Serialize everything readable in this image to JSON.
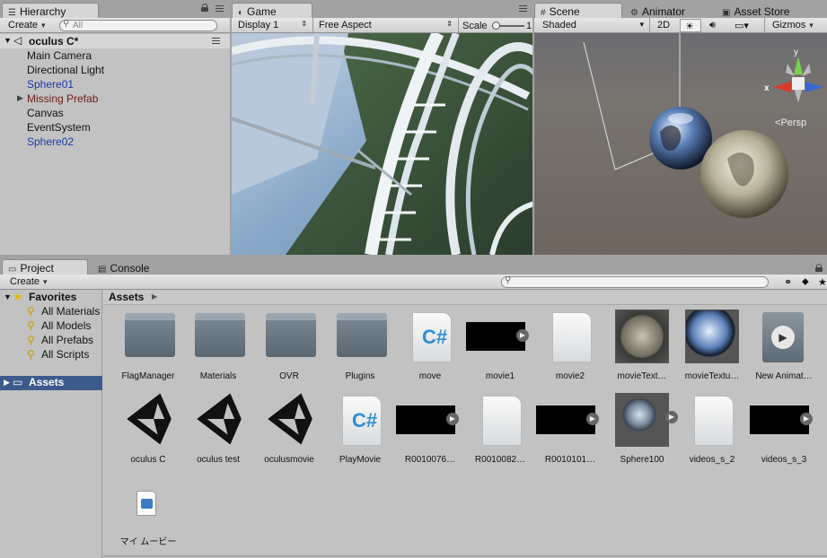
{
  "hierarchy": {
    "tab": "Hierarchy",
    "create": "Create",
    "search_placeholder": "All",
    "scene_name": "oculus C*",
    "items": [
      {
        "label": "Main Camera",
        "style": "normal"
      },
      {
        "label": "Directional Light",
        "style": "normal"
      },
      {
        "label": "Sphere01",
        "style": "blue"
      },
      {
        "label": "Missing Prefab",
        "style": "brown"
      },
      {
        "label": "Canvas",
        "style": "normal"
      },
      {
        "label": "EventSystem",
        "style": "normal"
      },
      {
        "label": "Sphere02",
        "style": "blue"
      }
    ]
  },
  "game": {
    "tab": "Game",
    "display": "Display 1",
    "aspect": "Free Aspect",
    "scale_label": "Scale",
    "scale_value": "1"
  },
  "scene": {
    "tab": "Scene",
    "tab_animator": "Animator",
    "tab_asset_store": "Asset Store",
    "shading": "Shaded",
    "mode_2d": "2D",
    "gizmos": "Gizmos",
    "persp_label": "Persp",
    "axis_y": "y",
    "axis_x": "x"
  },
  "project": {
    "tab": "Project",
    "tab_console": "Console",
    "create": "Create",
    "favorites_label": "Favorites",
    "favorites": [
      "All Materials",
      "All Models",
      "All Prefabs",
      "All Scripts"
    ],
    "assets_root": "Assets",
    "breadcrumb": "Assets",
    "assets": [
      {
        "name": "FlagManager",
        "kind": "folder"
      },
      {
        "name": "Materials",
        "kind": "folder"
      },
      {
        "name": "OVR",
        "kind": "folder"
      },
      {
        "name": "Plugins",
        "kind": "folder"
      },
      {
        "name": "move",
        "kind": "script"
      },
      {
        "name": "movie1",
        "kind": "movie"
      },
      {
        "name": "movie2",
        "kind": "doc"
      },
      {
        "name": "movieText…",
        "kind": "pano"
      },
      {
        "name": "movieTextu…",
        "kind": "sphere-tex"
      },
      {
        "name": "New Animat…",
        "kind": "anim"
      },
      {
        "name": "oculus C",
        "kind": "unity"
      },
      {
        "name": "oculus test",
        "kind": "unity"
      },
      {
        "name": "oculusmovie",
        "kind": "unity"
      },
      {
        "name": "PlayMovie",
        "kind": "script"
      },
      {
        "name": "R0010076…",
        "kind": "movie"
      },
      {
        "name": "R0010082…",
        "kind": "doc"
      },
      {
        "name": "R0010101…",
        "kind": "movie"
      },
      {
        "name": "Sphere100",
        "kind": "material"
      },
      {
        "name": "videos_s_2",
        "kind": "doc"
      },
      {
        "name": "videos_s_3",
        "kind": "movie"
      },
      {
        "name": "マイ ムービー",
        "kind": "media"
      }
    ]
  },
  "colors": {
    "blue_item": "#1a3ba8",
    "missing_prefab": "#6c1c14",
    "selection": "#3c5a8a",
    "scene_bg": "#736c66"
  }
}
